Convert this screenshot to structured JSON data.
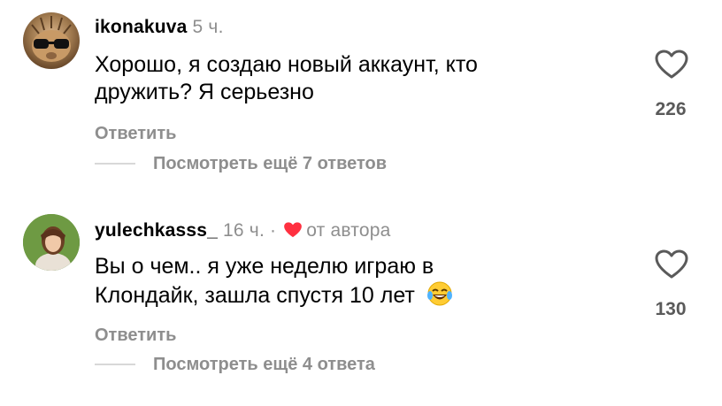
{
  "comments": [
    {
      "username": "ikonakuva",
      "time": "5 ч.",
      "author_badge": "",
      "text_line1": "Хорошо, я создаю новый аккаунт, кто",
      "text_line2": "дружить? Я серьезно",
      "like_count": "226",
      "reply_label": "Ответить",
      "more_replies_label": "Посмотреть ещё 7 ответов",
      "avatar_icon": "cat-with-sunglasses-avatar"
    },
    {
      "username": "yulechkasss_",
      "time": "16 ч.",
      "separator": "·",
      "author_badge": "от автора",
      "text_line1": "Вы о чем.. я уже неделю играю в",
      "text_line2": "Клондайк, зашла спустя 10 лет",
      "emoji": "face-with-tears-of-joy",
      "like_count": "130",
      "reply_label": "Ответить",
      "more_replies_label": "Посмотреть ещё 4 ответа",
      "avatar_icon": "girl-photo-avatar"
    }
  ],
  "colors": {
    "secondary_text": "#8e8e8e",
    "heart_red": "#ff3040",
    "divider": "#d8d8d8"
  }
}
